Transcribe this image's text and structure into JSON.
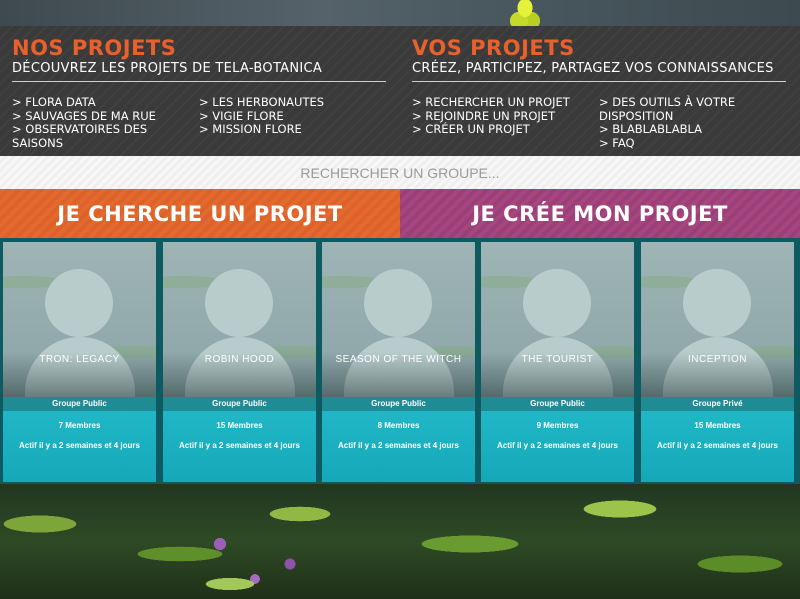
{
  "nos_projets": {
    "title": "Nos projets",
    "subtitle": "Découvrez les projets de Tela-Botanica",
    "links_col1": [
      "> Flora Data",
      "> Sauvages de ma rue",
      "> Observatoires des saisons"
    ],
    "links_col2": [
      "> Les Herbonautes",
      "> Vigie Flore",
      "> Mission Flore"
    ]
  },
  "vos_projets": {
    "title": "Vos projets",
    "subtitle": "Créez, participez, partagez vos connaissances",
    "links_col1": [
      "> Rechercher un projet",
      "> Rejoindre un projet",
      "> Créer un projet"
    ],
    "links_col2": [
      "> Des outils à votre disposition",
      "> Blablablabla",
      "> FAQ"
    ]
  },
  "search": {
    "placeholder": "Rechercher un groupe..."
  },
  "actions": {
    "search_project": "Je cherche un projet",
    "create_project": "Je crée mon projet"
  },
  "groups": [
    {
      "name": "Tron: Legacy",
      "type": "Groupe Public",
      "members": "7 Membres",
      "activity": "Actif il y a 2 semaines et 4 jours"
    },
    {
      "name": "Robin Hood",
      "type": "Groupe Public",
      "members": "15 Membres",
      "activity": "Actif il y a 2 semaines et 4 jours"
    },
    {
      "name": "Season of the Witch",
      "type": "Groupe Public",
      "members": "8 Membres",
      "activity": "Actif il y a 2 semaines et 4 jours"
    },
    {
      "name": "The Tourist",
      "type": "Groupe Public",
      "members": "9 Membres",
      "activity": "Actif il y a 2 semaines et 4 jours"
    },
    {
      "name": "Inception",
      "type": "Groupe Privé",
      "members": "15 Membres",
      "activity": "Actif il y a 2 semaines et 4 jours"
    }
  ],
  "colors": {
    "accent_orange": "#e36a2f",
    "accent_purple": "#a5467f",
    "teal": "#14a8b8",
    "header_bg": "#3a3a3a"
  }
}
